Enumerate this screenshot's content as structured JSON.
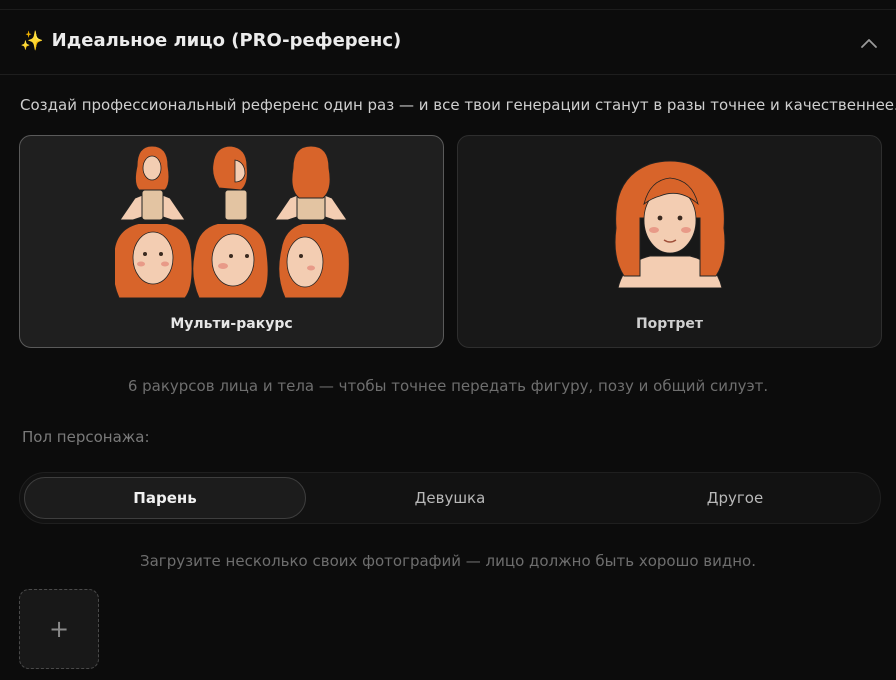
{
  "section": {
    "icon": "sparkles-icon",
    "title": "Идеальное лицо (PRO-референс)",
    "collapse_icon": "chevron-up-icon",
    "description": "Создай профессиональный референс один раз — и все твои генерации станут в разы точнее и качественнее."
  },
  "modes": [
    {
      "label": "Мульти-ракурс",
      "selected": true
    },
    {
      "label": "Портрет",
      "selected": false
    }
  ],
  "mode_hint": "6 ракурсов лица и тела — чтобы точнее передать фигуру, позу и общий силуэт.",
  "gender": {
    "label": "Пол персонажа:",
    "options": [
      {
        "label": "Парень",
        "active": true
      },
      {
        "label": "Девушка",
        "active": false
      },
      {
        "label": "Другое",
        "active": false
      }
    ]
  },
  "upload": {
    "hint": "Загрузите несколько своих фотографий — лицо должно быть хорошо видно.",
    "button_icon": "plus-icon",
    "button_symbol": "+"
  },
  "colors": {
    "background": "#0c0c0c",
    "card": "#181818",
    "hair": "#d8642a",
    "skin": "#f3cdb2"
  }
}
